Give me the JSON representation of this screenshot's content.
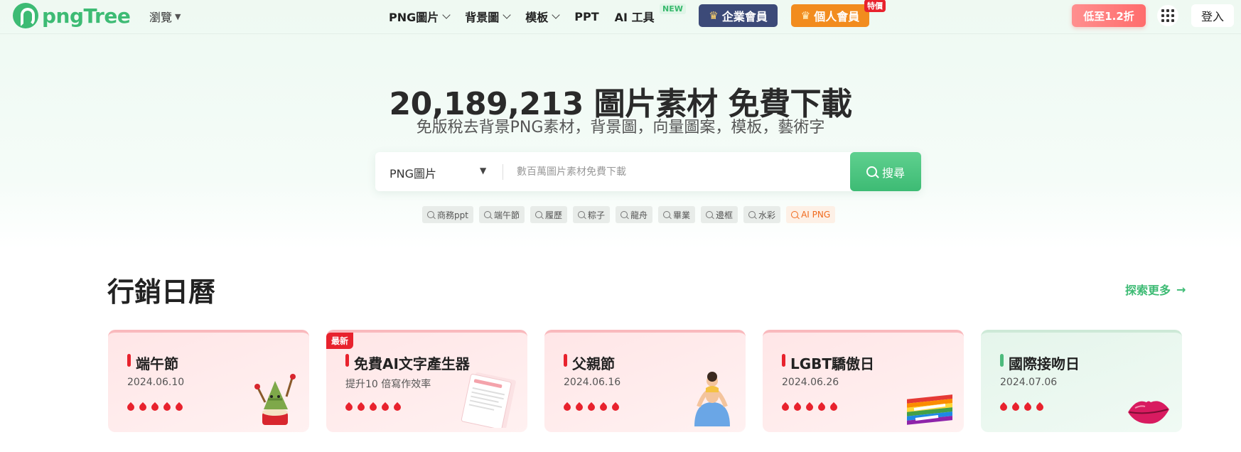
{
  "header": {
    "logo_text": "pngTree",
    "browse_label": "瀏覽",
    "nav": [
      {
        "label": "PNG圖片",
        "dropdown": true
      },
      {
        "label": "背景圖",
        "dropdown": true
      },
      {
        "label": "模板",
        "dropdown": true
      },
      {
        "label": "PPT",
        "dropdown": false
      },
      {
        "label": "AI 工具",
        "dropdown": false
      }
    ],
    "new_badge": "NEW",
    "enterprise_label": "企業會員",
    "personal_label": "個人會員",
    "special_badge": "特價",
    "discount_label": "低至1.2折",
    "login_label": "登入"
  },
  "hero": {
    "title": "20,189,213 圖片素材 免費下載",
    "subtitle": "免版稅去背景PNG素材，背景圖，向量圖案，模板，藝術字",
    "search_type": "PNG圖片",
    "search_placeholder": "數百萬圖片素材免費下載",
    "search_button": "搜尋",
    "tags": [
      "商務ppt",
      "端午節",
      "履歷",
      "粽子",
      "龍舟",
      "畢業",
      "邊框",
      "水彩"
    ],
    "ai_tag": "AI PNG"
  },
  "calendar": {
    "title": "行銷日曆",
    "explore_label": "探索更多",
    "new_badge": "最新",
    "cards": [
      {
        "title": "端午節",
        "date": "2024.06.10",
        "drops": 5,
        "theme": "pink",
        "illustration": "zongzi-drummer-icon"
      },
      {
        "title": "免費AI文字產生器",
        "date": "提升10 倍寫作效率",
        "drops": 5,
        "theme": "pink",
        "illustration": "document-pages-icon"
      },
      {
        "title": "父親節",
        "date": "2024.06.16",
        "drops": 5,
        "theme": "pink",
        "illustration": "father-child-icon"
      },
      {
        "title": "LGBT驕傲日",
        "date": "2024.06.26",
        "drops": 5,
        "theme": "pink",
        "illustration": "pride-day-icon"
      },
      {
        "title": "國際接吻日",
        "date": "2024.07.06",
        "drops": 4,
        "theme": "green",
        "illustration": "lips-icon"
      }
    ]
  },
  "colors": {
    "brand_green": "#3dbb74",
    "enterprise_navy": "#3c4a78",
    "personal_orange": "#f28c1e",
    "accent_red": "#e8222d"
  }
}
